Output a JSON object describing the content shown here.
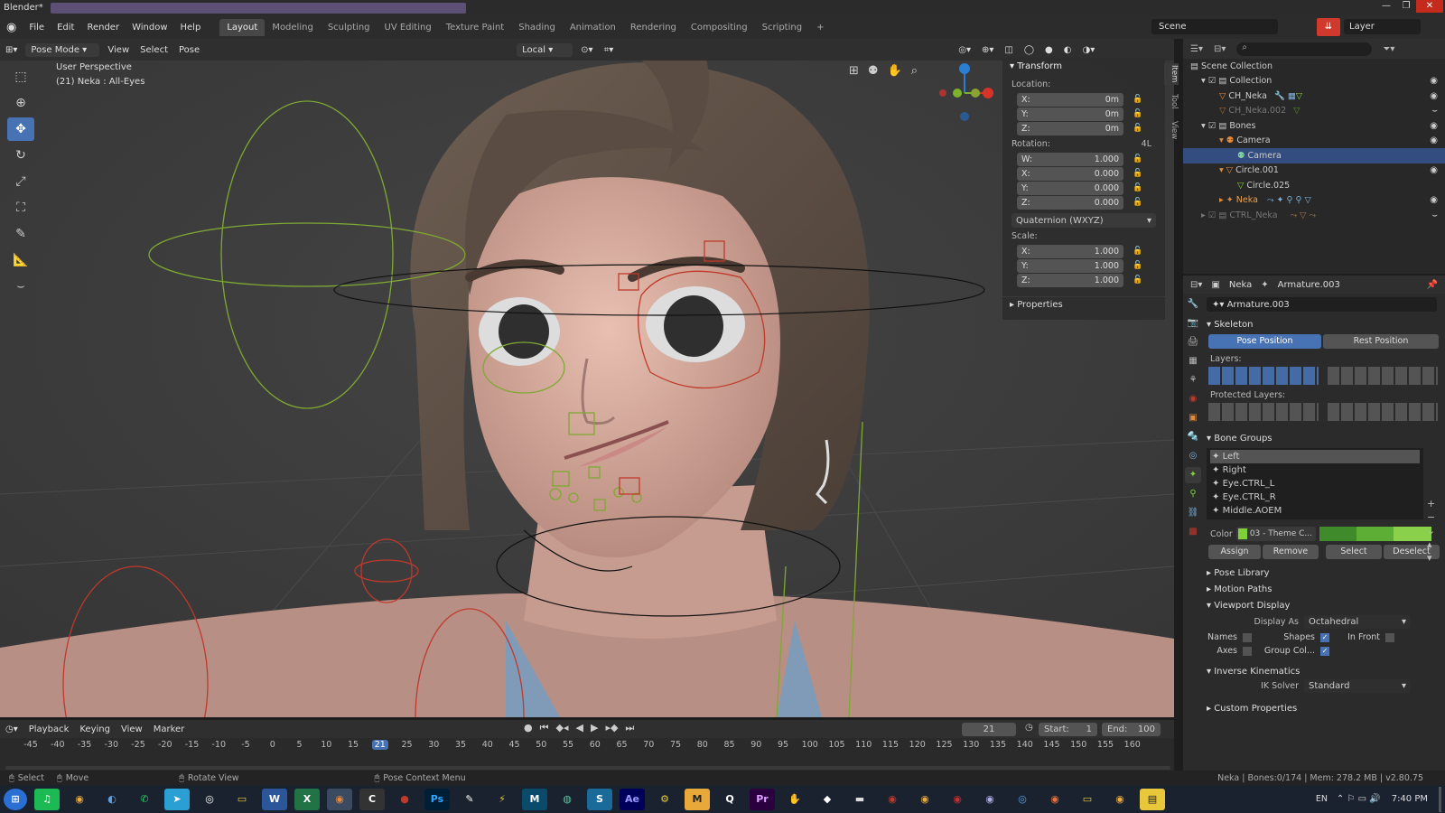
{
  "titlebar": {
    "title": "Blender*"
  },
  "menu": {
    "items": [
      "File",
      "Edit",
      "Render",
      "Window",
      "Help"
    ]
  },
  "workspaces": [
    "Layout",
    "Modeling",
    "Sculpting",
    "UV Editing",
    "Texture Paint",
    "Shading",
    "Animation",
    "Rendering",
    "Compositing",
    "Scripting"
  ],
  "scene": {
    "label": "Scene",
    "layer": "Layer"
  },
  "viewport": {
    "mode": "Pose Mode",
    "menus": [
      "View",
      "Select",
      "Pose"
    ],
    "orientation": "Local",
    "overlay_title": "User Perspective",
    "overlay_sub": "(21) Neka : All-Eyes"
  },
  "transform": {
    "title": "Transform",
    "location_label": "Location:",
    "location": [
      {
        "axis": "X:",
        "value": "0m"
      },
      {
        "axis": "Y:",
        "value": "0m"
      },
      {
        "axis": "Z:",
        "value": "0m"
      }
    ],
    "rotation_label": "Rotation:",
    "rotation_mode_short": "4L",
    "rotation": [
      {
        "axis": "W:",
        "value": "1.000"
      },
      {
        "axis": "X:",
        "value": "0.000"
      },
      {
        "axis": "Y:",
        "value": "0.000"
      },
      {
        "axis": "Z:",
        "value": "0.000"
      }
    ],
    "rotation_mode": "Quaternion (WXYZ)",
    "scale_label": "Scale:",
    "scale": [
      {
        "axis": "X:",
        "value": "1.000"
      },
      {
        "axis": "Y:",
        "value": "1.000"
      },
      {
        "axis": "Z:",
        "value": "1.000"
      }
    ],
    "properties": "Properties"
  },
  "npanel_tabs": [
    "Item",
    "Tool",
    "View"
  ],
  "outliner": {
    "root": "Scene Collection",
    "rows": [
      {
        "label": "Collection",
        "indent": 1
      },
      {
        "label": "CH_Neka",
        "indent": 2
      },
      {
        "label": "CH_Neka.002",
        "indent": 2
      },
      {
        "label": "Bones",
        "indent": 1
      },
      {
        "label": "Camera",
        "indent": 2
      },
      {
        "label": "Camera",
        "indent": 3
      },
      {
        "label": "Circle.001",
        "indent": 2
      },
      {
        "label": "Circle.025",
        "indent": 3
      },
      {
        "label": "Neka",
        "indent": 2
      },
      {
        "label": "CTRL_Neka",
        "indent": 1
      }
    ]
  },
  "props": {
    "object": "Neka",
    "armature": "Armature.003",
    "datablock": "Armature.003",
    "skeleton": "Skeleton",
    "pose_position": "Pose Position",
    "rest_position": "Rest Position",
    "layers": "Layers:",
    "protected_layers": "Protected Layers:",
    "bone_groups": "Bone Groups",
    "groups": [
      "Left",
      "Right",
      "Eye.CTRL_L",
      "Eye.CTRL_R",
      "Middle.AOEM"
    ],
    "color_label": "Color",
    "color_value": "03 - Theme C...",
    "assign": "Assign",
    "remove": "Remove",
    "select": "Select",
    "deselect": "Deselect",
    "pose_library": "Pose Library",
    "motion_paths": "Motion Paths",
    "viewport_display": "Viewport Display",
    "display_as_label": "Display As",
    "display_as": "Octahedral",
    "names": "Names",
    "shapes": "Shapes",
    "in_front": "In Front",
    "axes": "Axes",
    "group_col": "Group Col...",
    "ik": "Inverse Kinematics",
    "ik_solver_label": "IK Solver",
    "ik_solver": "Standard",
    "custom_props": "Custom Properties"
  },
  "timeline": {
    "menus": [
      "Playback",
      "Keying",
      "View",
      "Marker"
    ],
    "current": "21",
    "start_label": "Start:",
    "start": "1",
    "end_label": "End:",
    "end": "100",
    "ticks": [
      "-45",
      "-40",
      "-35",
      "-30",
      "-25",
      "-20",
      "-15",
      "-10",
      "-5",
      "0",
      "5",
      "10",
      "15",
      "21",
      "25",
      "30",
      "35",
      "40",
      "45",
      "50",
      "55",
      "60",
      "65",
      "70",
      "75",
      "80",
      "85",
      "90",
      "95",
      "100",
      "105",
      "110",
      "115",
      "120",
      "125",
      "130",
      "135",
      "140",
      "145",
      "150",
      "155",
      "160"
    ]
  },
  "status": {
    "select": "Select",
    "move": "Move",
    "rotate": "Rotate View",
    "context": "Pose Context Menu",
    "info": "Neka | Bones:0/174 | Mem: 278.2 MB | v2.80.75"
  },
  "taskbar": {
    "lang": "EN",
    "time": "7:40 PM"
  },
  "colors": {
    "accent": "#4772b3",
    "bone_green": "#7fa832",
    "bone_red": "#c0392b"
  }
}
